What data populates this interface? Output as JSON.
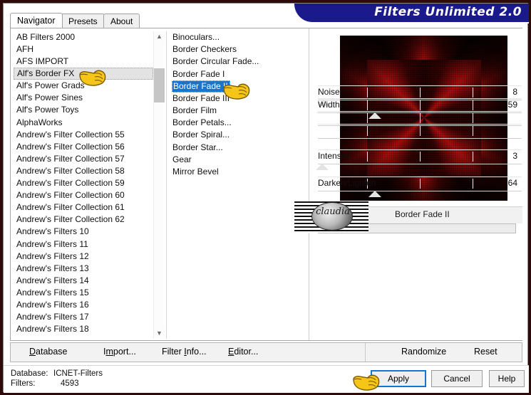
{
  "window": {
    "title": "Filters Unlimited 2.0",
    "frame_color": "#2e0a0a",
    "banner_color": "#1a1a8c"
  },
  "tabs": [
    {
      "label": "Navigator",
      "active": true
    },
    {
      "label": "Presets",
      "active": false
    },
    {
      "label": "About",
      "active": false
    }
  ],
  "navigator": {
    "selected": "Alf's Border FX",
    "items": [
      "AB Filters 2000",
      "AFH",
      "AFS IMPORT",
      "Alf's Border FX",
      "Alf's Power Grads",
      "Alf's Power Sines",
      "Alf's Power Toys",
      "AlphaWorks",
      "Andrew's Filter Collection 55",
      "Andrew's Filter Collection 56",
      "Andrew's Filter Collection 57",
      "Andrew's Filter Collection 58",
      "Andrew's Filter Collection 59",
      "Andrew's Filter Collection 60",
      "Andrew's Filter Collection 61",
      "Andrew's Filter Collection 62",
      "Andrew's Filters 10",
      "Andrew's Filters 11",
      "Andrew's Filters 12",
      "Andrew's Filters 13",
      "Andrew's Filters 14",
      "Andrew's Filters 15",
      "Andrew's Filters 16",
      "Andrew's Filters 17",
      "Andrew's Filters 18"
    ]
  },
  "filters": {
    "selected": "Border Fade II",
    "items": [
      "Binoculars...",
      "Border Checkers",
      "Border Circular Fade...",
      "Border Fade I",
      "Border Fade II",
      "Border Fade III",
      "Border Film",
      "Border Petals...",
      "Border Spiral...",
      "Border Star...",
      "Gear",
      "Mirror Bevel"
    ]
  },
  "preview": {
    "effect_name": "Border Fade II",
    "colors": {
      "accent_red": "#c01010",
      "dark": "#0a0000"
    }
  },
  "parameters": {
    "title": "Border Fade II",
    "rows": [
      {
        "label": "Noise",
        "value": "8",
        "thumb_pct": 3
      },
      {
        "label": "Width",
        "value": "59",
        "thumb_pct": 28
      },
      {
        "label": "",
        "value": "",
        "thumb_pct": -1
      },
      {
        "label": "",
        "value": "",
        "thumb_pct": -1
      },
      {
        "label": "Intensity",
        "value": "3",
        "thumb_pct": 2
      },
      {
        "label": "Darken/Lighten",
        "value": "64",
        "thumb_pct": 28
      }
    ]
  },
  "watermark": {
    "text": "claudia"
  },
  "toolbar": {
    "left": [
      {
        "label": "Database",
        "accel": "D"
      },
      {
        "label": "Import...",
        "accel": "m"
      },
      {
        "label": "Filter Info...",
        "accel": "I"
      },
      {
        "label": "Editor...",
        "accel": "E"
      }
    ],
    "right": [
      {
        "label": "Randomize"
      },
      {
        "label": "Reset"
      }
    ]
  },
  "status": {
    "database_label": "Database:",
    "database_value": "ICNET-Filters",
    "filters_label": "Filters:",
    "filters_value": "4593"
  },
  "dialog_buttons": [
    {
      "label": "Apply",
      "focused": true
    },
    {
      "label": "Cancel",
      "focused": false
    },
    {
      "label": "Help",
      "focused": false
    }
  ],
  "cursors": [
    {
      "name": "pointing-hand-navigator"
    },
    {
      "name": "pointing-hand-filter"
    },
    {
      "name": "pointing-hand-apply"
    }
  ]
}
